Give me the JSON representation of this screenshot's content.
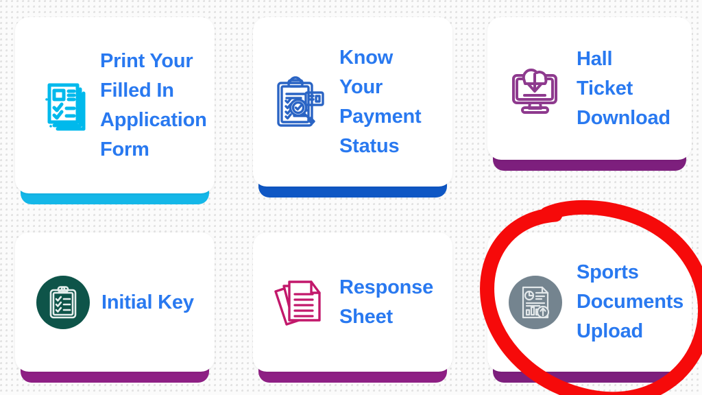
{
  "page": {
    "background_color": "#fbfbfb",
    "dot_color": "#e2e2e2",
    "card_color": "#ffffff",
    "label_color": "#2979f0"
  },
  "cards": [
    {
      "id": "print-application-form",
      "label": "Print Your\nFilled In\nApplication\nForm",
      "icon": "stacked-form-checklist-icon",
      "icon_color": "#00b9ec",
      "accent_bar_color": "#14b7e8"
    },
    {
      "id": "know-payment-status",
      "label": "Know\nYour\nPayment\nStatus",
      "icon": "clipboard-magnifier-check-icon",
      "icon_color": "#2a64c4",
      "accent_bar_color": "#0f57c4"
    },
    {
      "id": "hall-ticket-download",
      "label": "Hall\nTicket\nDownload",
      "icon": "cloud-download-monitor-icon",
      "icon_color": "#8e3a8e",
      "accent_bar_color": "#7d1f7d"
    },
    {
      "id": "initial-key",
      "label": "Initial Key",
      "icon": "clipboard-checklist-circle-icon",
      "icon_color": "#ffffff",
      "icon_bg_color": "#0e5449",
      "accent_bar_color": "#8e1f84"
    },
    {
      "id": "response-sheet",
      "label": "Response\nSheet",
      "icon": "stacked-documents-icon",
      "icon_color": "#c2186b",
      "accent_bar_color": "#8e1f84"
    },
    {
      "id": "sports-documents-upload",
      "label": "Sports\nDocuments\nUpload",
      "icon": "report-upload-circle-icon",
      "icon_color": "#e3e8ea",
      "icon_bg_color": "#74848f",
      "accent_bar_color": "#7d1f7d"
    }
  ],
  "annotation": {
    "name": "red-highlight-circle",
    "color": "#f60a0a",
    "stroke_width": 21,
    "target_card": "sports-documents-upload"
  }
}
